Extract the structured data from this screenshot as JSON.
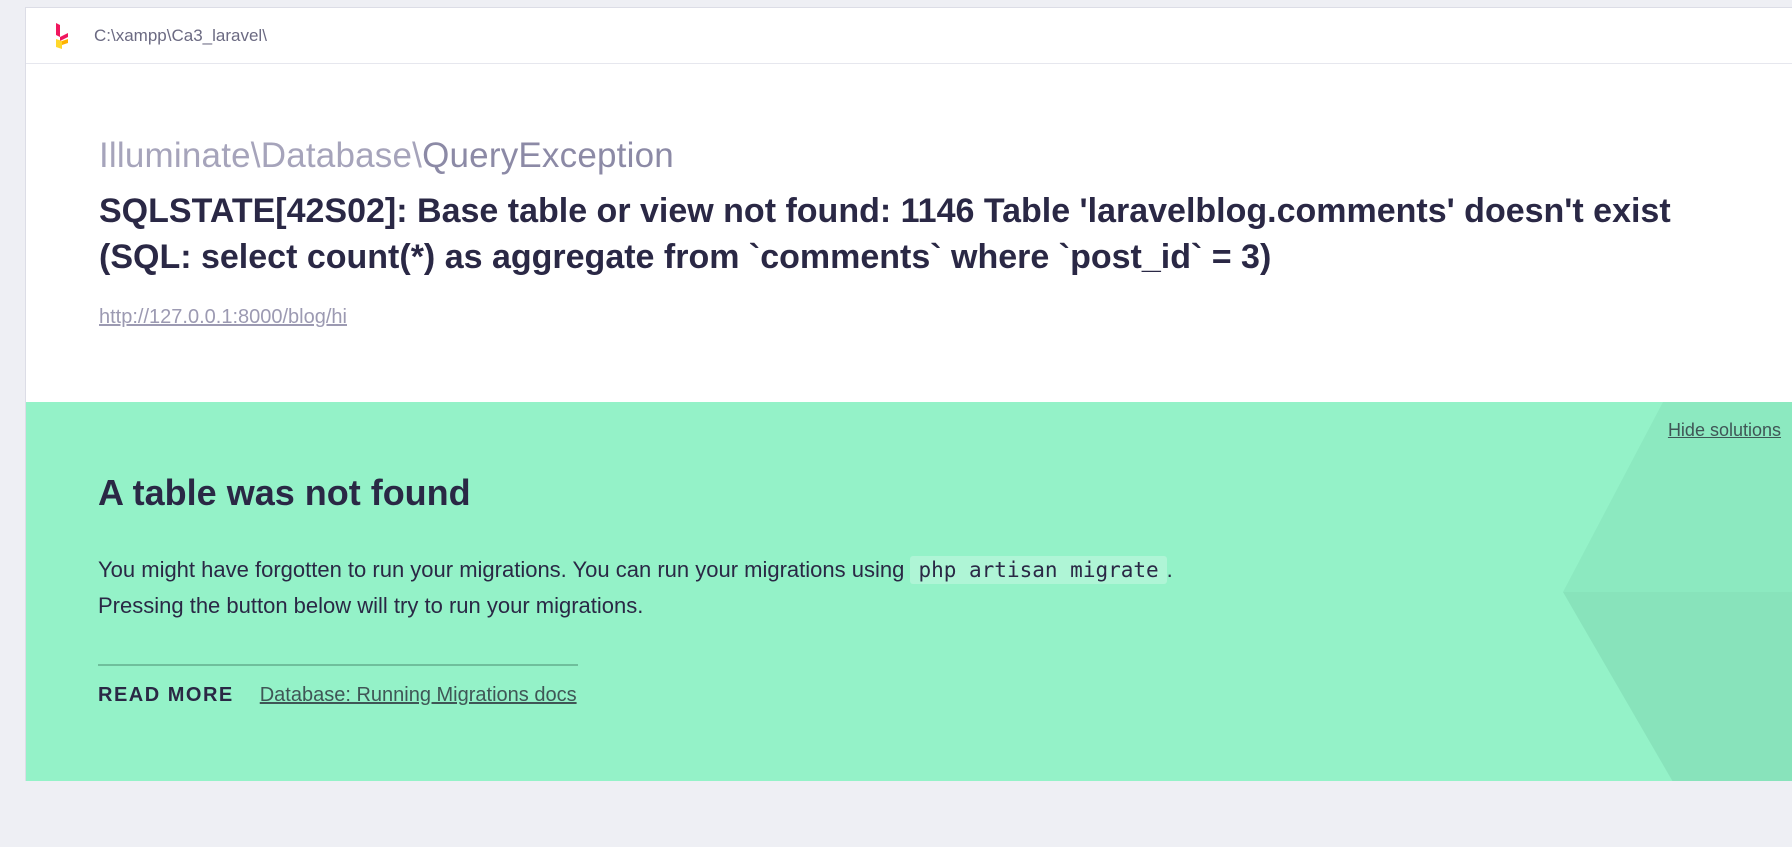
{
  "topbar": {
    "app_path": "C:\\xampp\\Ca3_laravel\\"
  },
  "exception": {
    "class_prefix": "Illuminate\\Database\\",
    "class_name": "QueryException",
    "message": "SQLSTATE[42S02]: Base table or view not found: 1146 Table 'laravelblog.comments' doesn't exist (SQL: select count(*) as aggregate from `comments` where `post_id` = 3)",
    "url": "http://127.0.0.1:8000/blog/hi"
  },
  "solution": {
    "hide_label": "Hide solutions",
    "title": "A table was not found",
    "desc_part1": "You might have forgotten to run your migrations. You can run your migrations using ",
    "desc_code": "php artisan migrate",
    "desc_part2": ".",
    "desc_line2": "Pressing the button below will try to run your migrations.",
    "read_more_label": "READ MORE",
    "doc_link_label": "Database: Running Migrations docs"
  },
  "colors": {
    "background": "#eeeff4",
    "card": "#ffffff",
    "solution_bg": "#94f2c8",
    "text_dark": "#2a2845",
    "text_muted": "#a6a4bb",
    "logo_red": "#f0175e",
    "logo_yellow": "#ffd72a"
  },
  "icons": {
    "logo": "ignition-logo-icon"
  }
}
